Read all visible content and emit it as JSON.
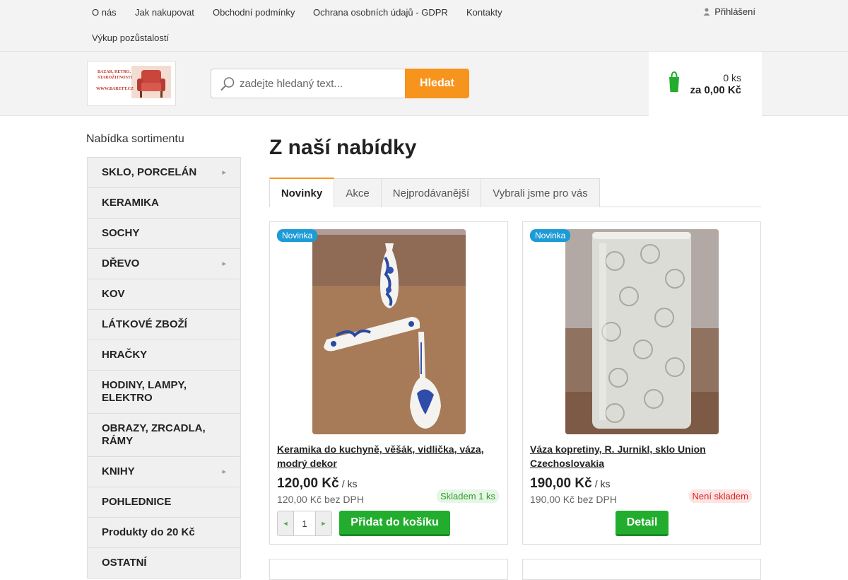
{
  "topnav": {
    "items": [
      "O nás",
      "Jak nakupovat",
      "Obchodní podmínky",
      "Ochrana osobních údajů - GDPR",
      "Kontakty",
      "Výkup pozůstalostí"
    ],
    "login_label": "Přihlášení"
  },
  "header": {
    "logo_lines": [
      "BAZAR, RETRO,",
      "STAROŽITNOSTI",
      "WWW.BARETT.CZ"
    ],
    "search_placeholder": "zadejte hledaný text...",
    "search_button": "Hledat",
    "cart_qty": "0 ks",
    "cart_total": "za 0,00 Kč"
  },
  "sidebar": {
    "title": "Nabídka sortimentu",
    "categories": [
      {
        "label": "SKLO, PORCELÁN",
        "has_sub": true
      },
      {
        "label": "KERAMIKA",
        "has_sub": false
      },
      {
        "label": "SOCHY",
        "has_sub": false
      },
      {
        "label": "DŘEVO",
        "has_sub": true
      },
      {
        "label": "KOV",
        "has_sub": false
      },
      {
        "label": "LÁTKOVÉ ZBOŽÍ",
        "has_sub": false
      },
      {
        "label": "HRAČKY",
        "has_sub": false
      },
      {
        "label": "HODINY, LAMPY, ELEKTRO",
        "has_sub": false
      },
      {
        "label": "OBRAZY, ZRCADLA, RÁMY",
        "has_sub": false
      },
      {
        "label": "KNIHY",
        "has_sub": true
      },
      {
        "label": "POHLEDNICE",
        "has_sub": false
      },
      {
        "label": "Produkty do 20 Kč",
        "has_sub": false
      },
      {
        "label": "OSTATNÍ",
        "has_sub": false
      }
    ]
  },
  "main": {
    "title": "Z naší nabídky",
    "tabs": [
      {
        "label": "Novinky",
        "active": true
      },
      {
        "label": "Akce",
        "active": false
      },
      {
        "label": "Nejprodávanější",
        "active": false
      },
      {
        "label": "Vybrali jsme pro vás",
        "active": false
      }
    ],
    "products": [
      {
        "badge": "Novinka",
        "name": "Keramika do kuchyně, věšák, vidlička, váza, modrý dekor",
        "price": "120,00 Kč",
        "unit": "/ ks",
        "price_net": "120,00 Kč bez DPH",
        "stock": "Skladem 1 ks",
        "in_stock": true,
        "quantity": "1",
        "button": "Přidat do košíku"
      },
      {
        "badge": "Novinka",
        "name": "Váza kopretiny, R. Jurnikl, sklo Union Czechoslovakia",
        "price": "190,00 Kč",
        "unit": "/ ks",
        "price_net": "190,00 Kč bez DPH",
        "stock": "Není skladem",
        "in_stock": false,
        "button": "Detail"
      }
    ]
  },
  "colors": {
    "accent": "#f7941d",
    "buy_button": "#22ad2e",
    "badge": "#1d9bd7",
    "in_stock": "#2a9d2a",
    "out_of_stock": "#d92525"
  },
  "icons": {
    "login": "user-icon",
    "search": "magnifier-icon",
    "cart": "cart-icon",
    "submenu": "chevron-right-icon",
    "qty_minus": "minus-icon",
    "qty_plus": "plus-icon"
  }
}
